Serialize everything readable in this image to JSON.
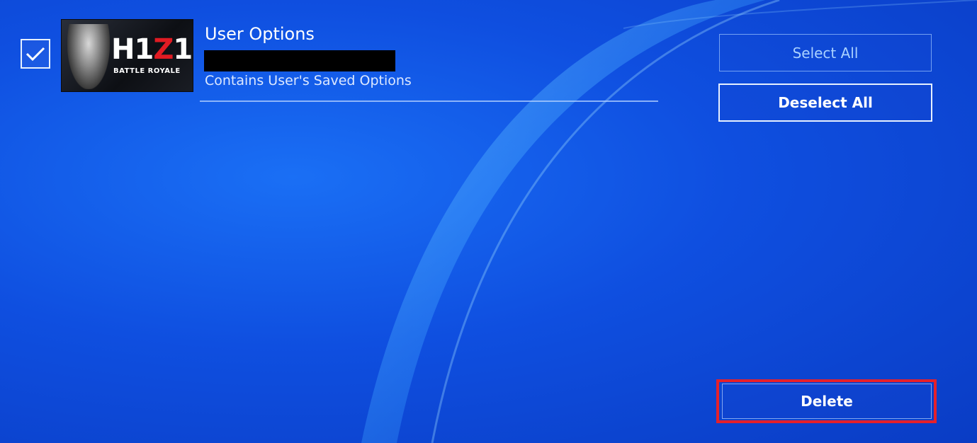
{
  "item": {
    "checked": true,
    "title": "User Options",
    "description": "Contains User's Saved Options",
    "thumbnail": {
      "logo_main": "H1",
      "logo_accent": "Z",
      "logo_end": "1",
      "logo_sub": "BATTLE ROYALE",
      "accent_color": "#e01b23"
    }
  },
  "buttons": {
    "select_all": "Select All",
    "deselect_all": "Deselect All",
    "delete": "Delete"
  },
  "colors": {
    "background": "#0f4fe0",
    "highlight": "#e5202b"
  }
}
